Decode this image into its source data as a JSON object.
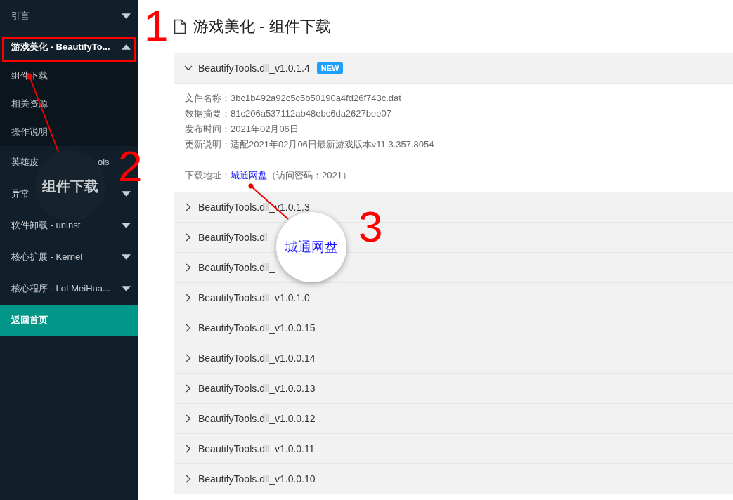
{
  "sidebar": {
    "items": [
      {
        "label": "引言",
        "expanded": false
      },
      {
        "label": "游戏美化 - BeautifyTo...",
        "expanded": true,
        "children": [
          {
            "label": "组件下载"
          },
          {
            "label": "相关资源"
          },
          {
            "label": "操作说明"
          }
        ]
      },
      {
        "label": "英雄皮",
        "label_end": "ols"
      },
      {
        "label": "异常",
        "expanded": false
      },
      {
        "label": "软件卸载 - uninst",
        "expanded": false
      },
      {
        "label": "核心扩展 - Kernel",
        "expanded": false
      },
      {
        "label": "核心程序 - LoLMeiHua...",
        "expanded": false
      }
    ],
    "home_button": "返回首页"
  },
  "page": {
    "title": "游戏美化 - 组件下载",
    "releases": [
      {
        "name": "BeautifyTools.dll_v1.0.1.4",
        "badge": "NEW",
        "expanded": true,
        "details": [
          "文件名称：3bc1b492a92c5c5b50190a4fd26f743c.dat",
          "数据摘要：81c206a537112ab48ebc6da2627bee07",
          "发布时间：2021年02月06日",
          "更新说明：适配2021年02月06日最新游戏版本v11.3.357.8054"
        ],
        "download": {
          "label": "下载地址：",
          "link": "城通网盘",
          "note": "（访问密码：2021）"
        }
      },
      {
        "name": "BeautifyTools.dll_v1.0.1.3",
        "expanded": false
      },
      {
        "name": "BeautifyTools.dl",
        "expanded": false
      },
      {
        "name": "BeautifyTools.dll_",
        "expanded": false
      },
      {
        "name": "BeautifyTools.dll_v1.0.1.0",
        "expanded": false
      },
      {
        "name": "BeautifyTools.dll_v1.0.0.15",
        "expanded": false
      },
      {
        "name": "BeautifyTools.dll_v1.0.0.14",
        "expanded": false
      },
      {
        "name": "BeautifyTools.dll_v1.0.0.13",
        "expanded": false
      },
      {
        "name": "BeautifyTools.dll_v1.0.0.12",
        "expanded": false
      },
      {
        "name": "BeautifyTools.dll_v1.0.0.11",
        "expanded": false
      },
      {
        "name": "BeautifyTools.dll_v1.0.0.10",
        "expanded": false
      }
    ]
  },
  "annotations": {
    "step_numbers": [
      "1",
      "2",
      "3"
    ],
    "magnifiers": [
      {
        "text": "组件下载",
        "kind": "dark"
      },
      {
        "text": "城通网盘",
        "kind": "light"
      }
    ]
  }
}
